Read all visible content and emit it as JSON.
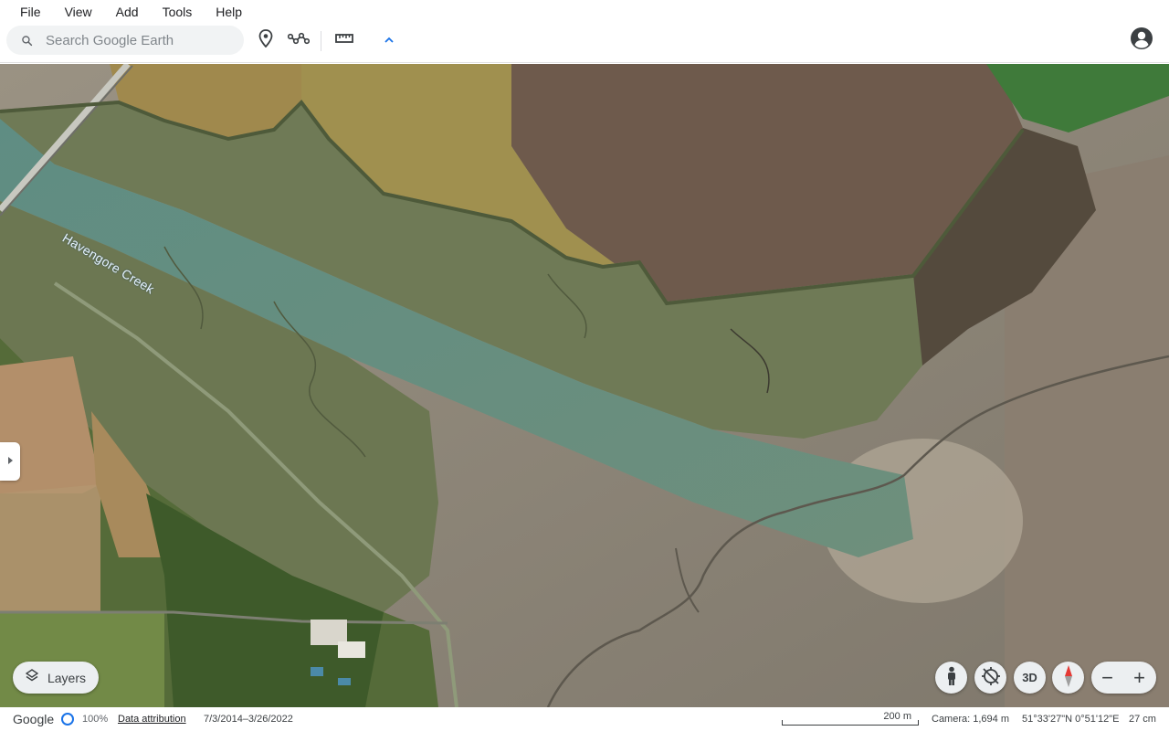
{
  "menu": {
    "items": [
      "File",
      "View",
      "Add",
      "Tools",
      "Help"
    ]
  },
  "toolbar": {
    "search_placeholder": "Search Google Earth",
    "icons": [
      "placemark-icon",
      "path-icon",
      "ruler-icon",
      "chevron-up-icon"
    ]
  },
  "map": {
    "feature_label": "Havengore Creek"
  },
  "controls": {
    "layers_label": "Layers",
    "view_3d_label": "3D",
    "zoom_out_label": "−",
    "zoom_in_label": "+"
  },
  "status": {
    "logo": "Google",
    "load_percent": "100%",
    "attribution_label": "Data attribution",
    "imagery_dates": "7/3/2014–3/26/2022",
    "scale_label": "200 m",
    "camera": "Camera: 1,694 m",
    "coordinates": "51°33'27\"N 0°51'12\"E",
    "elevation": "27 cm"
  },
  "colors": {
    "accent": "#1a73e8",
    "compass_red": "#e53935"
  }
}
